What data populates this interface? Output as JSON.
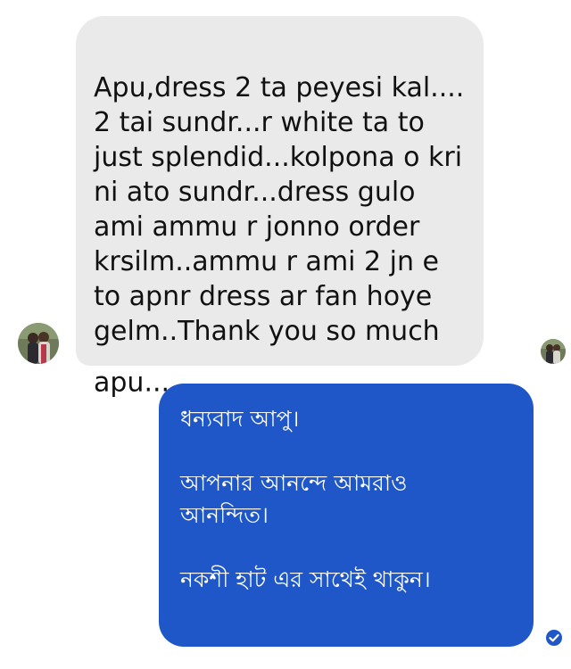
{
  "conversation": {
    "incoming": {
      "text": "Apu,dress 2 ta peyesi kal....\n2 tai sundr...r white ta to\njust splendid...kolpona o kri\nni ato sundr...dress gulo\nami ammu r jonno order\nkrsilm..ammu r ami 2 jn e\nto apnr dress ar fan hoye\ngelm..Thank you so much\napu....",
      "emoji": "❤️❤️❤️❤️",
      "heart_color": "#e0132a"
    },
    "outgoing": {
      "paragraphs": [
        "ধন্যবাদ আপু।",
        "আপনার আনন্দে আমরাও\nআনন্দিত।",
        "নকশী হাট এর সাথেই থাকুন।"
      ],
      "bubble_color": "#1f57c9"
    },
    "icons": {
      "sender_avatar": "profile-photo-avatar",
      "seen_avatar": "seen-by-avatar",
      "read_receipt": "check-circle-icon"
    },
    "colors": {
      "incoming_bubble": "#eaeaea",
      "read_receipt": "#1f57c9"
    }
  }
}
